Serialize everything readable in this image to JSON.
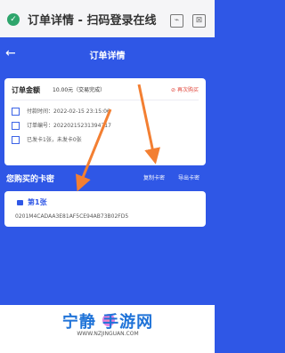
{
  "app": {
    "window_title": "订单详情 - 扫码登录在线",
    "nav_title": "订单详情"
  },
  "order": {
    "amount_label": "订单金额",
    "amount_value": "10.00元（交易完成）",
    "rebuy_label": "再次购买",
    "pay_time": "付款时间：2022-02-15 23:15:06",
    "order_no": "订单编号：20220215231394717",
    "delivery": "已发卡1张，未发卡0张"
  },
  "card_section": {
    "title": "您购买的卡密",
    "copy_label": "复制卡密",
    "export_label": "导出卡密",
    "cards": [
      {
        "name": "第1张",
        "code": "0201M4CADAA3E81AF5CE94AB73B02FD5"
      }
    ]
  },
  "footer": {
    "brand": "宁静 手游网",
    "url": "WWW.NZJINGUAN.COM"
  },
  "colors": {
    "primary": "#2f57e6",
    "accent_red": "#e0463b",
    "arrow_orange": "#f37f32"
  }
}
